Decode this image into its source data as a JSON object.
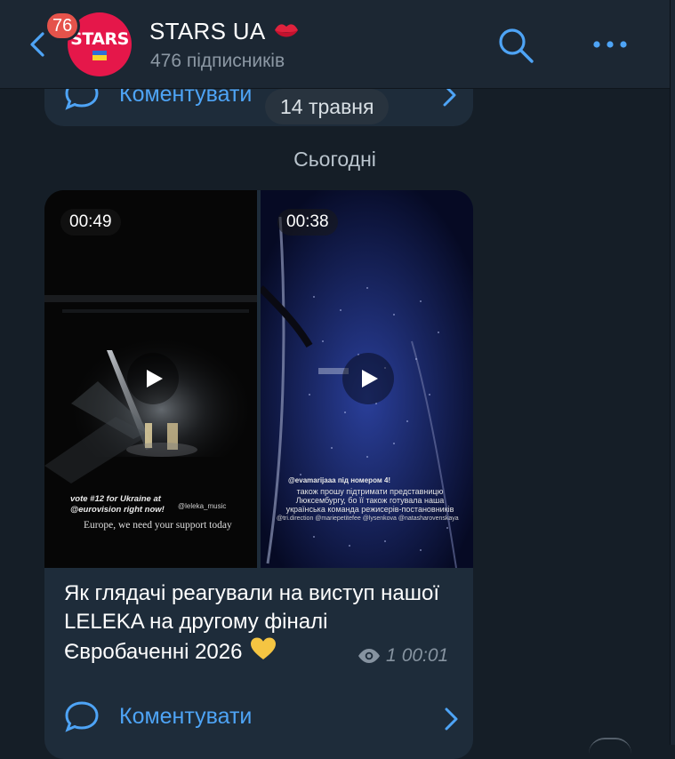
{
  "header": {
    "back_label": "back",
    "unread_count": "76",
    "channel_title": "STARS UA",
    "title_emoji_icon": "kiss-lips-icon",
    "subscribers": "476 підписників",
    "avatar_text": "STARS"
  },
  "feed": {
    "previous_message": {
      "comment_label": "Коментувати",
      "date_pill": "14 травня"
    },
    "day_separator": "Сьогодні",
    "message": {
      "videos": [
        {
          "duration": "00:49",
          "overlay_line1": "vote #12 for Ukraine at",
          "overlay_line2": "@eurovision right now!",
          "overlay_tag": "@leleka_music",
          "overlay_footer": "Europe, we need your support today"
        },
        {
          "duration": "00:38",
          "overlay_mention": "@evamarijaaa під номером 4!",
          "overlay_text": "також прошу підтримати представницю Люксембургу, бо її також готувала наша українська команда режисерів-постановників",
          "overlay_tags": "@tri.direction @mariepetitefee @lysenkova @natasharovenskaya"
        }
      ],
      "caption": "Як глядачі реагували на виступ нашої LELEKA на другому фіналі Євробаченні 2026",
      "caption_emoji_icon": "yellow-heart-icon",
      "views": "1",
      "time": "00:01",
      "comment_label": "Коментувати"
    }
  },
  "colors": {
    "background": "#151e27",
    "header": "#1c2733",
    "bubble": "#1e2c3a",
    "accent": "#4ea4f6",
    "badge": "#e5534b",
    "avatar": "#e5174a"
  }
}
